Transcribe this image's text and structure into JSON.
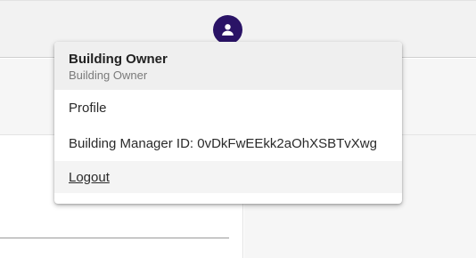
{
  "user_menu": {
    "name": "Building Owner",
    "role": "Building Owner",
    "items": [
      {
        "label": "Profile"
      },
      {
        "label": "Building Manager ID: 0vDkFwEEkk2aOhXSBTvXwg"
      },
      {
        "label": "Logout"
      }
    ]
  },
  "header": {
    "avatar_icon": "account-circle-icon",
    "avatar_color": "#2a1366"
  }
}
